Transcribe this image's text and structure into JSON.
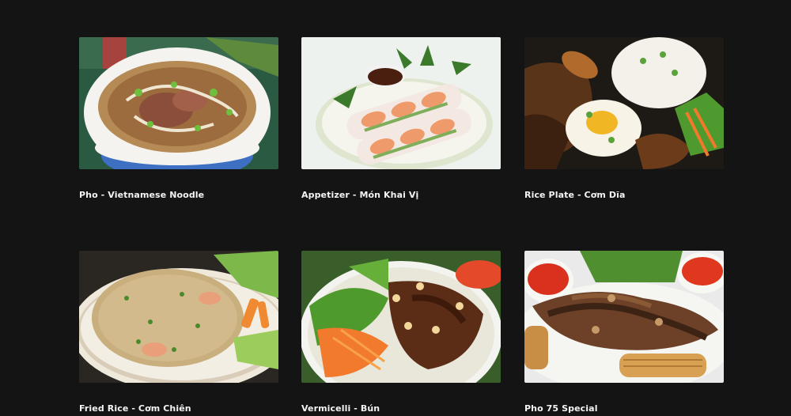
{
  "menu": {
    "items": [
      {
        "label": "Pho - Vietnamese Noodle",
        "image": "pho-bowl"
      },
      {
        "label": "Appetizer - Món Khai Vị",
        "image": "spring-rolls"
      },
      {
        "label": "Rice Plate - Cơm Dĩa",
        "image": "rice-plate"
      },
      {
        "label": "Fried Rice - Cơm Chiên",
        "image": "fried-rice"
      },
      {
        "label": "Vermicelli - Bún",
        "image": "vermicelli-bowl"
      },
      {
        "label": "Pho 75 Special",
        "image": "pho-special-platter"
      }
    ]
  }
}
